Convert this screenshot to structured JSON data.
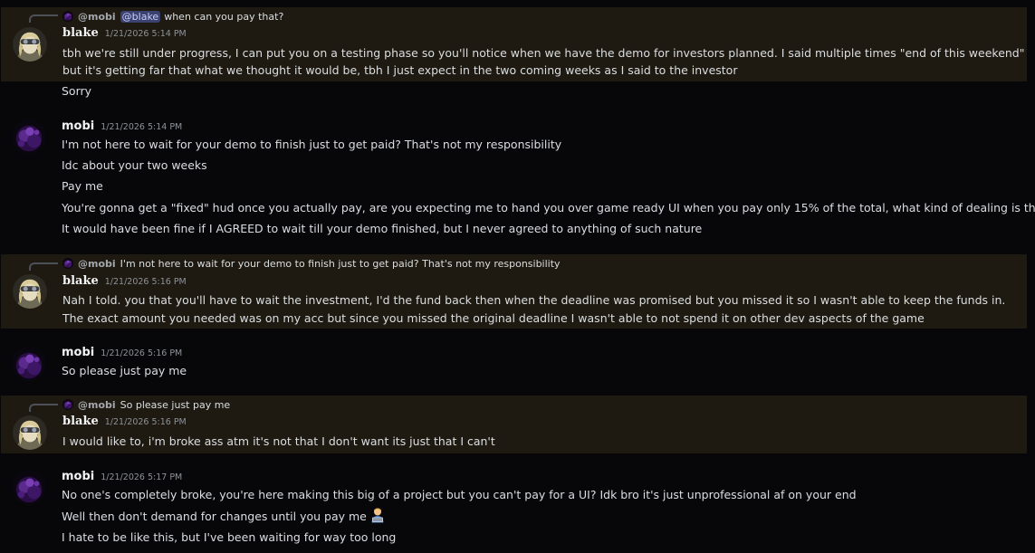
{
  "messages": [
    {
      "author": "blake",
      "timestamp": "1/21/2026 5:14 PM",
      "reply": {
        "author": "@mobi",
        "mention": "@blake",
        "text": "when can you pay that?"
      },
      "lines": [
        "tbh we're still under progress, I can put you on a testing phase so you'll notice when we have the demo for investors planned. I said multiple times \"end of this weekend\"",
        "but it's getting far that what we thought it would be, tbh I just expect in the two coming weeks as I said to the investor",
        "Sorry"
      ]
    },
    {
      "author": "mobi",
      "timestamp": "1/21/2026 5:14 PM",
      "lines": [
        "I'm not here to wait for your demo to finish just to get paid? That's not my responsibility",
        "Idc about your two weeks",
        "Pay me",
        "You're gonna get a \"fixed\"  hud once you actually pay, are you expecting me to hand you over game ready UI when you pay only 15% of the total, what kind of dealing is that",
        "It would have been fine if I AGREED to wait till your demo finished, but I never agreed to anything of such nature"
      ]
    },
    {
      "author": "blake",
      "timestamp": "1/21/2026 5:16 PM",
      "reply": {
        "author": "@mobi",
        "text": "I'm not here to wait for your demo to finish just to get paid? That's not my responsibility"
      },
      "lines": [
        "Nah I told. you that you'll have to wait the investment, I'd the fund back then when the deadline was promised but you missed it so I wasn't able to keep the funds in. The exact amount you needed was on my acc but since you missed the original deadline I wasn't able to not spend it on other dev aspects of the game"
      ]
    },
    {
      "author": "mobi",
      "timestamp": "1/21/2026 5:16 PM",
      "lines": [
        "So please just pay me"
      ]
    },
    {
      "author": "blake",
      "timestamp": "1/21/2026 5:16 PM",
      "reply": {
        "author": "@mobi",
        "text": "So please just pay me"
      },
      "lines": [
        "I would like to, i'm broke ass atm it's not that I don't want its just that I can't"
      ]
    },
    {
      "author": "mobi",
      "timestamp": "1/21/2026 5:17 PM",
      "lines": [
        "No one's completely broke, you're here making this big of a project but you can't pay for a UI? Idk bro it's just unprofessional af on your end",
        "Well then don't demand for changes until you pay me",
        "I hate to be like this, but I've been waiting for way too long"
      ],
      "emoji": "man-technologist-emoji"
    }
  ],
  "colors": {
    "background": "#070709",
    "mention_highlight": "#1e1a11",
    "text": "#dbdee1",
    "timestamp": "#8e9297",
    "mention_pill": "#3c4270"
  }
}
